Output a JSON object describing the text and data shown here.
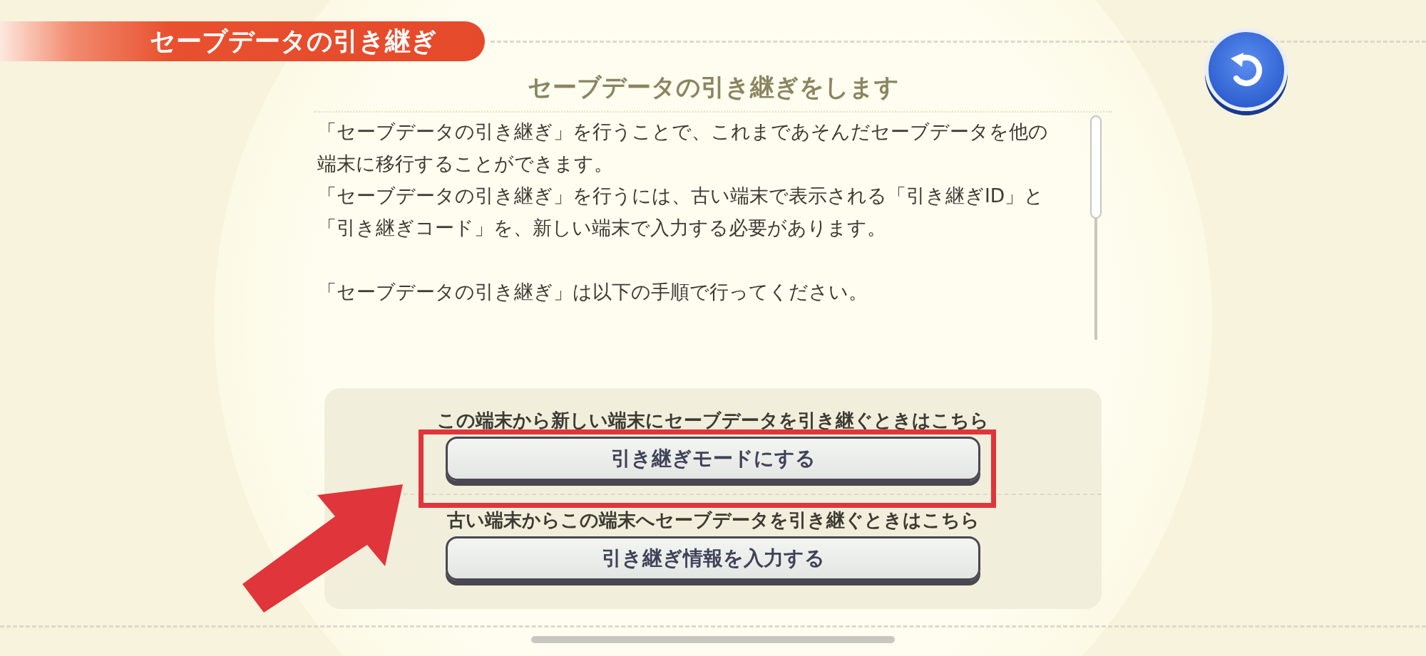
{
  "header": {
    "title": "セーブデータの引き継ぎ"
  },
  "heading": "セーブデータの引き継ぎをします",
  "paragraphs": [
    "「セーブデータの引き継ぎ」を行うことで、これまであそんだセーブデータを他の端末に移行することができます。",
    "「セーブデータの引き継ぎ」を行うには、古い端末で表示される「引き継ぎID」と「引き継ぎコード」を、新しい端末で入力する必要があります。",
    "「セーブデータの引き継ぎ」は以下の手順で行ってください。"
  ],
  "options": [
    {
      "caption": "この端末から新しい端末にセーブデータを引き継ぐときはこちら",
      "button": "引き継ぎモードにする",
      "highlighted": true
    },
    {
      "caption": "古い端末からこの端末へセーブデータを引き継ぐときはこちら",
      "button": "引き継ぎ情報を入力する",
      "highlighted": false
    }
  ]
}
